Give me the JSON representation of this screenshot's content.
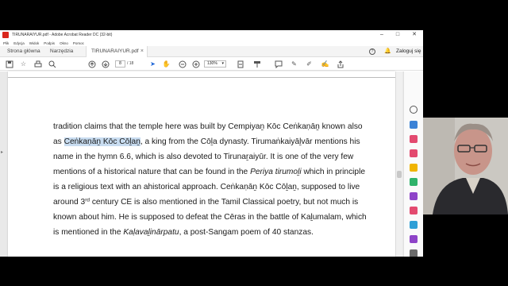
{
  "window": {
    "title": "TIRUNARAIYUR.pdf - Adobe Acrobat Reader DC (32-bit)",
    "minimize": "–",
    "maximize": "□",
    "close": "✕"
  },
  "menu": [
    "Plik",
    "Edycja",
    "Widok",
    "Podpis",
    "Okno",
    "Pomoc"
  ],
  "tabs": {
    "home": "Strona główna",
    "tools": "Narzędzia",
    "doc": "TIRUNARAIYUR.pdf",
    "doc_close": "×",
    "login": "Zaloguj się"
  },
  "toolbar": {
    "page_current": "8",
    "page_total": "/ 18",
    "zoom": "130%"
  },
  "document": {
    "lines": [
      {
        "pre": "tradition claims that the temple here was built by Cempiyaṉ Kōc Ceṅkaṇāṉ known also",
        "hl": "",
        "post": ""
      },
      {
        "pre": "as ",
        "hl": "Ceṅkaṇāṉ Kōc Cōḻaṉ",
        "post": ", a king from the Cōḻa dynasty. Tirumaṅkaiyāḻvār mentions his"
      },
      {
        "pre": "name in the hymn 6.6, which is also devoted to Tirunaṟaiyūr. It is one of the very few",
        "hl": "",
        "post": ""
      },
      {
        "pre": "mentions of a historical nature that can be found in the ",
        "it": "Periya tirumoḻi",
        "post": " which in principle"
      },
      {
        "pre": "is a religious text with an ahistorical approach. Ceṅkaṇāṉ Kōc Cōḻaṉ, supposed to live",
        "hl": "",
        "post": ""
      },
      {
        "pre": "around 3",
        "sup": "rd",
        "post": " century CE is also mentioned in the Tamil Classical poetry, but not much is"
      },
      {
        "pre": "known about him. He is supposed to defeat the Cēras in the battle of Kaḻumalam, which",
        "hl": "",
        "post": ""
      },
      {
        "pre": "is mentioned in the ",
        "it": "Kaḷavaḻinārpatu",
        "post": ", a post-Sangam poem of 40 stanzas."
      }
    ]
  },
  "colors": {
    "acrobat_red": "#d9261c",
    "highlight": "#c8dcf0"
  }
}
